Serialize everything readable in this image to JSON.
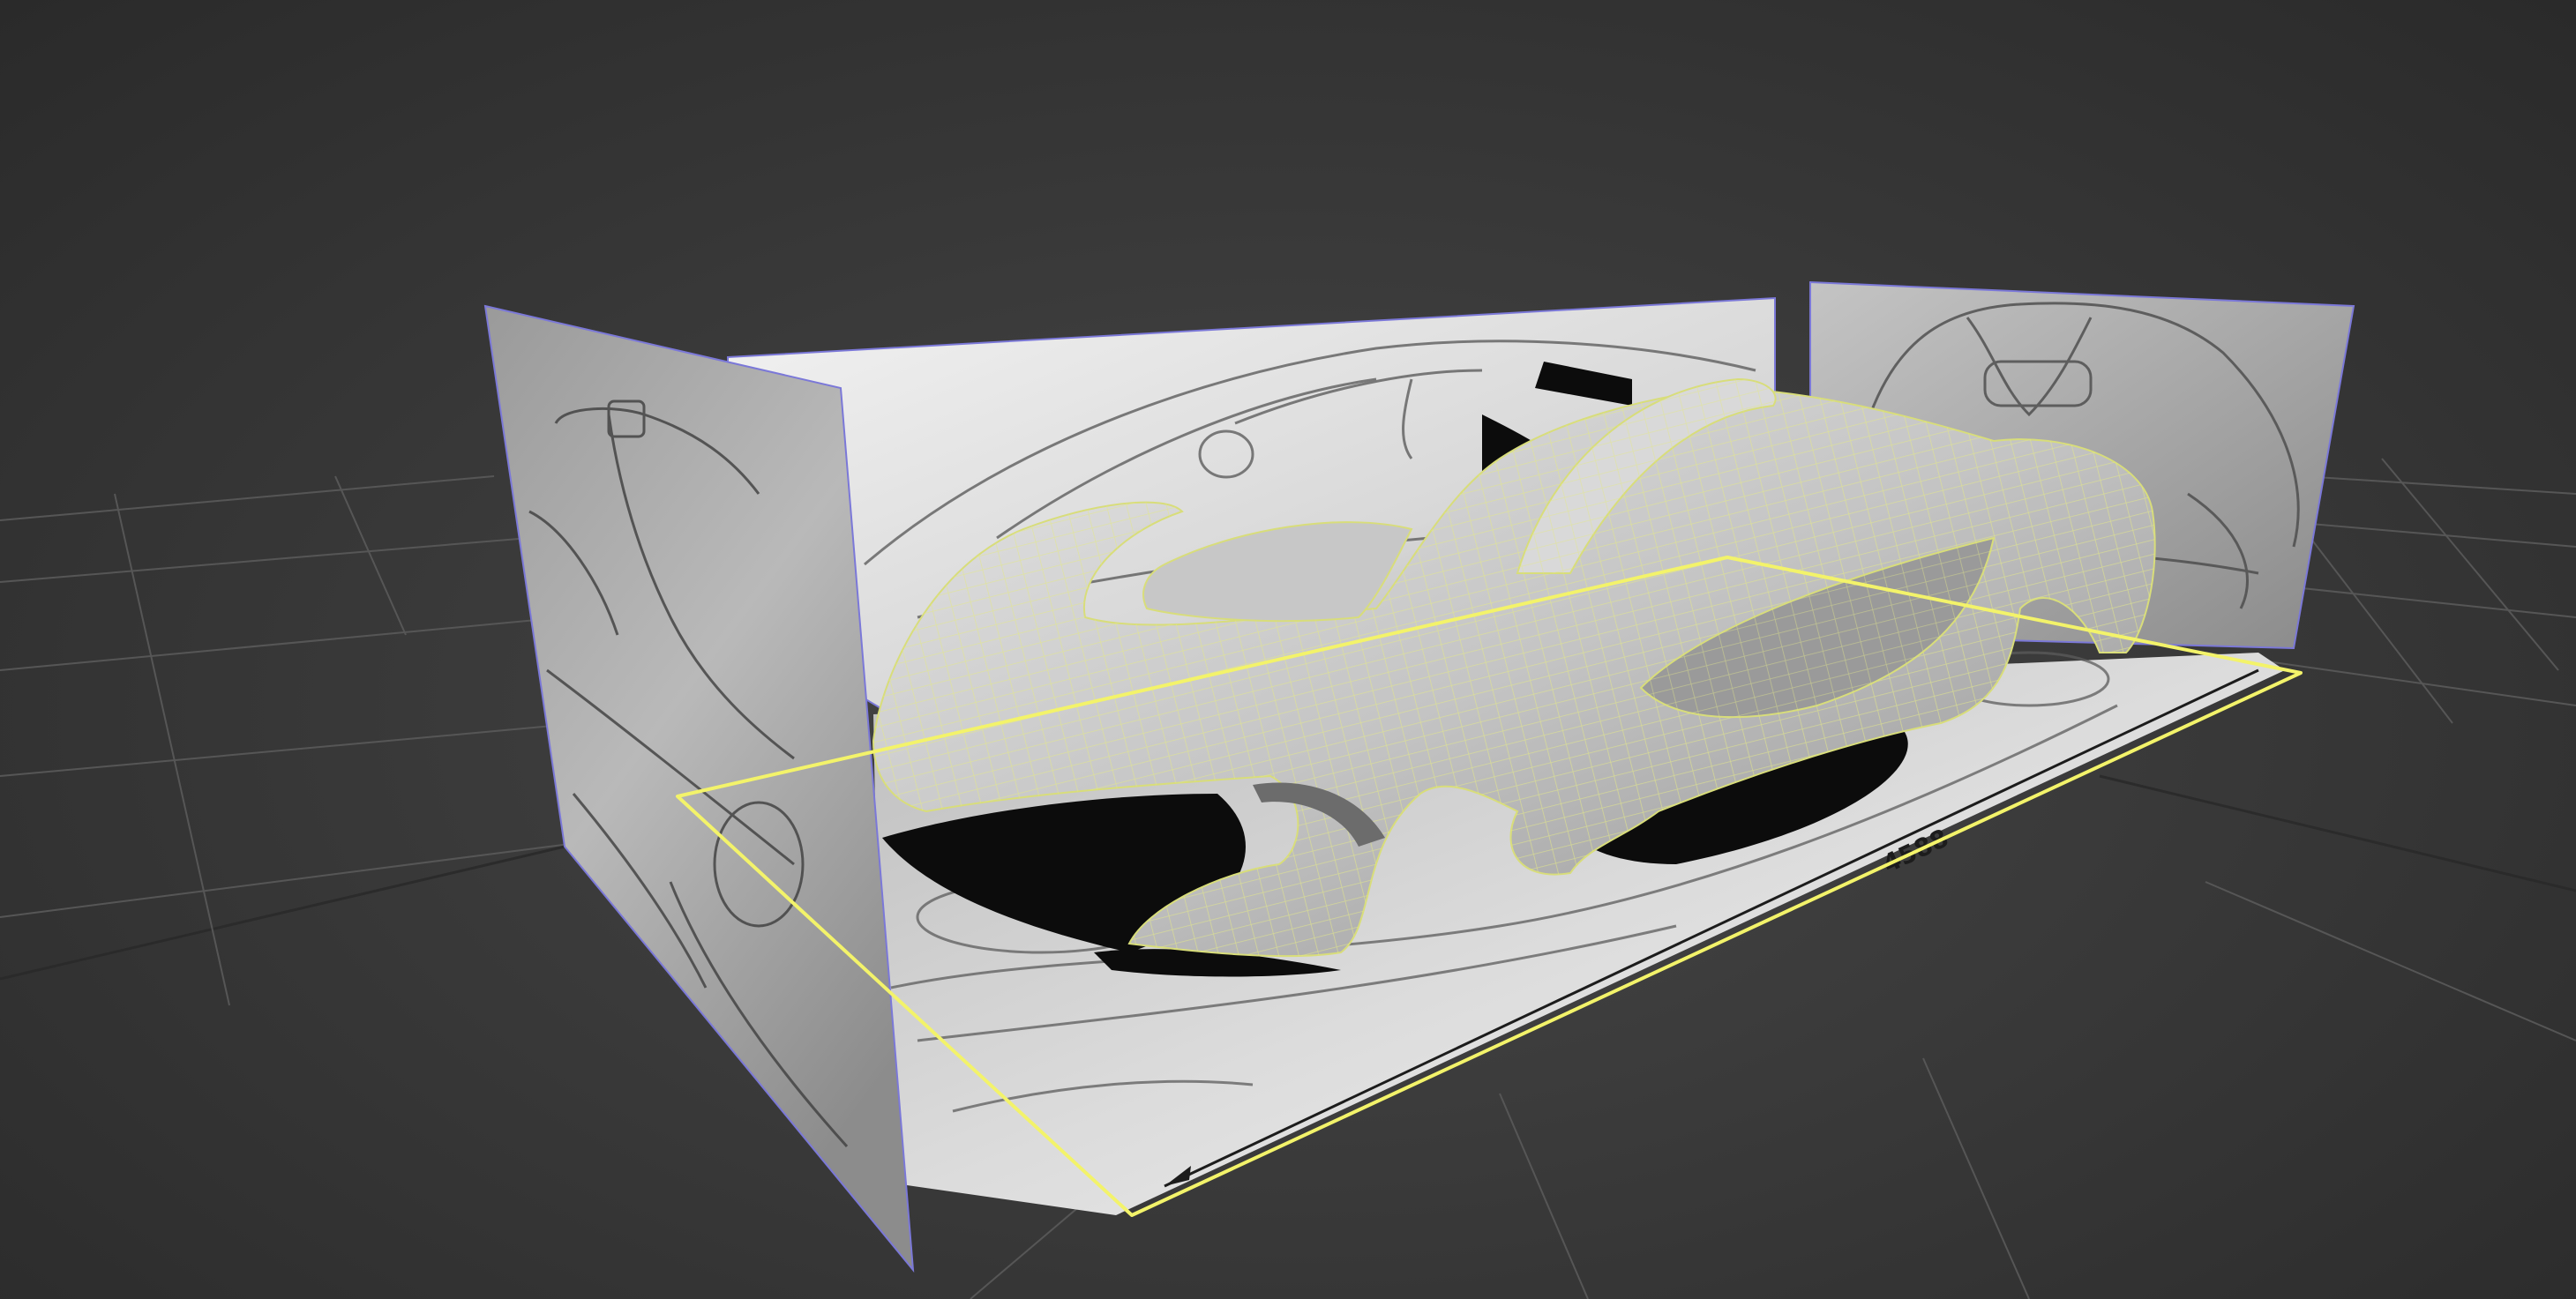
{
  "viewport": {
    "background_color": "#3b3b3b",
    "grid_color": "#5a5a5a",
    "selection_color": "#f3f36a",
    "reference_plane_edge_color": "#7b78d8",
    "wireframe_color": "#e3e88a"
  },
  "scene": {
    "reference_planes": [
      "front-view-plane",
      "side-view-plane",
      "rear-view-plane",
      "top-view-plane"
    ],
    "dimension_label": "4588"
  }
}
